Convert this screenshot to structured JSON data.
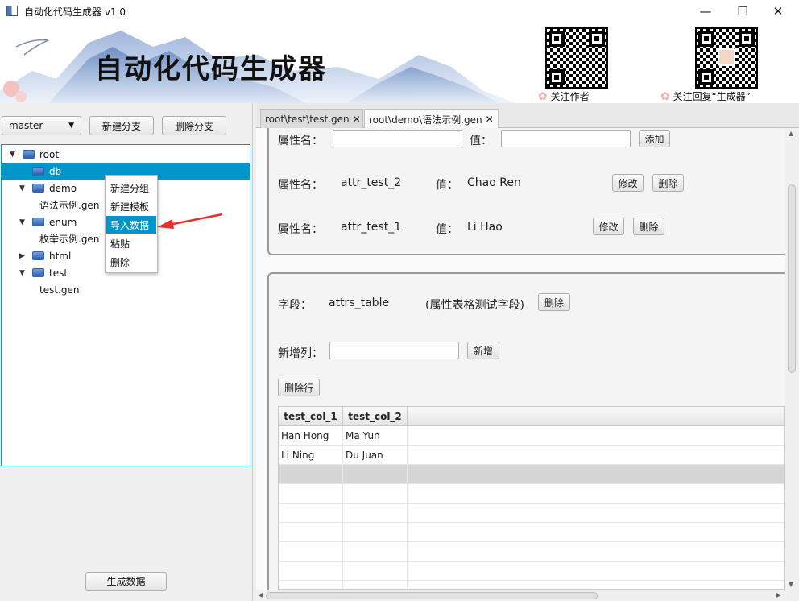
{
  "window": {
    "title": "自动化代码生成器 v1.0",
    "controls": {
      "minimize": "—",
      "maximize": "☐",
      "close": "✕"
    }
  },
  "banner": {
    "title": "自动化代码生成器",
    "qr1_caption": "关注作者",
    "qr2_caption": "关注回复“生成器”"
  },
  "left": {
    "branch_select": "master",
    "new_branch": "新建分支",
    "delete_branch": "删除分支",
    "generate": "生成数据",
    "tree": [
      {
        "label": "root",
        "level": 0,
        "expanded": true,
        "folder": true
      },
      {
        "label": "db",
        "level": 1,
        "expanded": false,
        "folder": true,
        "selected": true
      },
      {
        "label": "demo",
        "level": 1,
        "expanded": true,
        "folder": true
      },
      {
        "label": "语法示例.gen",
        "level": 2,
        "folder": false
      },
      {
        "label": "enum",
        "level": 1,
        "expanded": true,
        "folder": true
      },
      {
        "label": "枚举示例.gen",
        "level": 2,
        "folder": false
      },
      {
        "label": "html",
        "level": 1,
        "expanded": false,
        "folder": true,
        "collapsed": true
      },
      {
        "label": "test",
        "level": 1,
        "expanded": true,
        "folder": true
      },
      {
        "label": "test.gen",
        "level": 2,
        "folder": false
      }
    ],
    "context_menu": [
      "新建分组",
      "新建模板",
      "导入数据",
      "粘贴",
      "删除"
    ],
    "context_hover_index": 2
  },
  "tabs": [
    {
      "label": "root\\test\\test.gen",
      "close": "✕"
    },
    {
      "label": "root\\demo\\语法示例.gen",
      "close": "✕"
    }
  ],
  "attrs": {
    "name_label": "属性名：",
    "value_label": "值：",
    "add": "添加",
    "modify": "修改",
    "delete": "删除",
    "rows": [
      {
        "name": "attr_test_2",
        "value": "Chao Ren"
      },
      {
        "name": "attr_test_1",
        "value": "Li Hao"
      }
    ]
  },
  "field": {
    "field_label": "字段：",
    "field_name": "attrs_table",
    "field_desc": "(属性表格测试字段)",
    "delete": "删除",
    "new_col_label": "新增列：",
    "add_col": "新增",
    "delete_row": "删除行",
    "columns": [
      "test_col_1",
      "test_col_2"
    ],
    "rows": [
      [
        "Han Hong",
        "Ma Yun"
      ],
      [
        "Li Ning",
        "Du Juan"
      ]
    ]
  },
  "colors": {
    "selection": "#0096c9",
    "arrow": "#e8302a"
  }
}
